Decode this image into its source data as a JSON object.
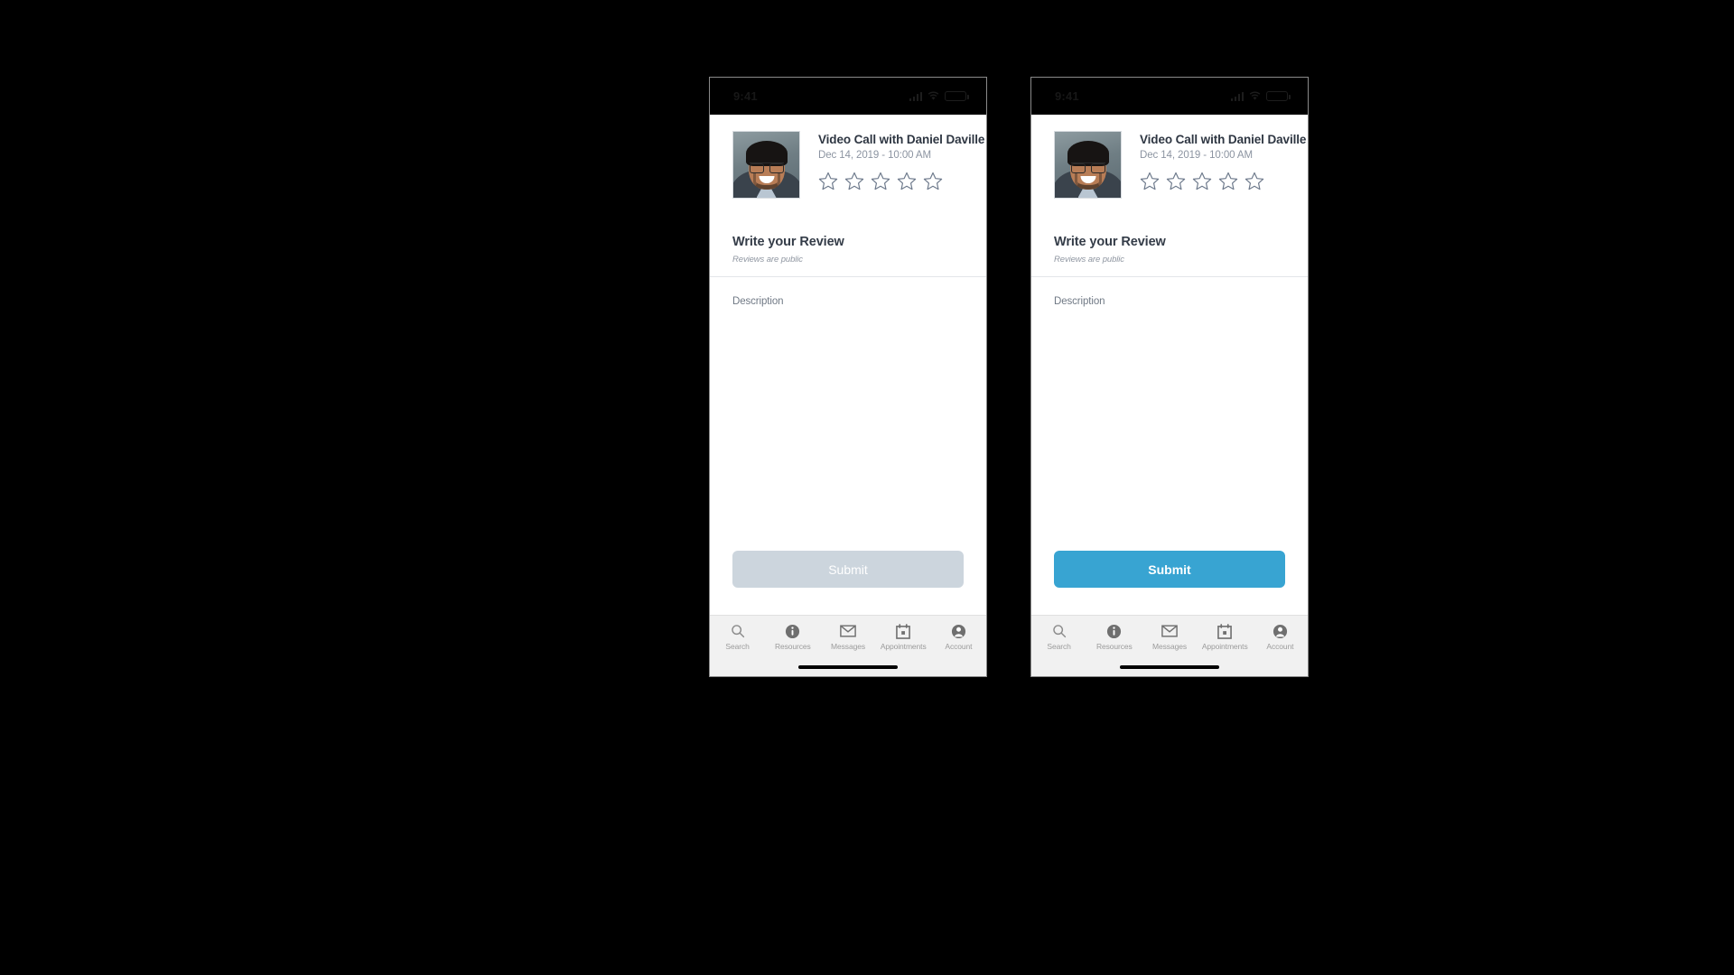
{
  "background_color": "#000000",
  "colors": {
    "accent_blue": "#38a4d2",
    "disabled_gray": "#ccd5dd",
    "star_outline": "#6e7a8c",
    "title_text": "#2e3642",
    "muted_text": "#8c94a1",
    "tabbar_bg": "#f1f1f1",
    "tab_label": "#9b9b9b",
    "statusbar_bg": "#000000"
  },
  "phones": [
    {
      "id": "phone-disabled-state",
      "status_bar": {
        "time": "9:41",
        "signal_icon": "signal-bars-icon",
        "wifi_icon": "wifi-icon",
        "battery_icon": "battery-icon"
      },
      "appointment": {
        "avatar_alt": "Daniel Daville profile photo",
        "title": "Video Call with Daniel Daville",
        "datetime": "Dec 14, 2019 - 10:00 AM",
        "rating": {
          "value": 0,
          "max": 5,
          "star_icon": "star-outline-icon"
        }
      },
      "review": {
        "heading": "Write your Review",
        "subtitle": "Reviews are public"
      },
      "description": {
        "placeholder": "Description",
        "value": ""
      },
      "submit": {
        "label": "Submit",
        "state": "disabled"
      },
      "tabbar": [
        {
          "label": "Search",
          "icon": "search-icon",
          "active": false
        },
        {
          "label": "Resources",
          "icon": "info-circle-icon",
          "active": false
        },
        {
          "label": "Messages",
          "icon": "envelope-icon",
          "active": false
        },
        {
          "label": "Appointments",
          "icon": "calendar-icon",
          "active": false
        },
        {
          "label": "Account",
          "icon": "account-circle-icon",
          "active": false
        }
      ],
      "home_indicator": true
    },
    {
      "id": "phone-enabled-state",
      "status_bar": {
        "time": "9:41",
        "signal_icon": "signal-bars-icon",
        "wifi_icon": "wifi-icon",
        "battery_icon": "battery-icon"
      },
      "appointment": {
        "avatar_alt": "Daniel Daville profile photo",
        "title": "Video Call with Daniel Daville",
        "datetime": "Dec 14, 2019 - 10:00 AM",
        "rating": {
          "value": 0,
          "max": 5,
          "star_icon": "star-outline-icon"
        }
      },
      "review": {
        "heading": "Write your Review",
        "subtitle": "Reviews are public"
      },
      "description": {
        "placeholder": "Description",
        "value": ""
      },
      "submit": {
        "label": "Submit",
        "state": "enabled"
      },
      "tabbar": [
        {
          "label": "Search",
          "icon": "search-icon",
          "active": false
        },
        {
          "label": "Resources",
          "icon": "info-circle-icon",
          "active": false
        },
        {
          "label": "Messages",
          "icon": "envelope-icon",
          "active": false
        },
        {
          "label": "Appointments",
          "icon": "calendar-icon",
          "active": false
        },
        {
          "label": "Account",
          "icon": "account-circle-icon",
          "active": false
        }
      ],
      "home_indicator": true
    }
  ]
}
